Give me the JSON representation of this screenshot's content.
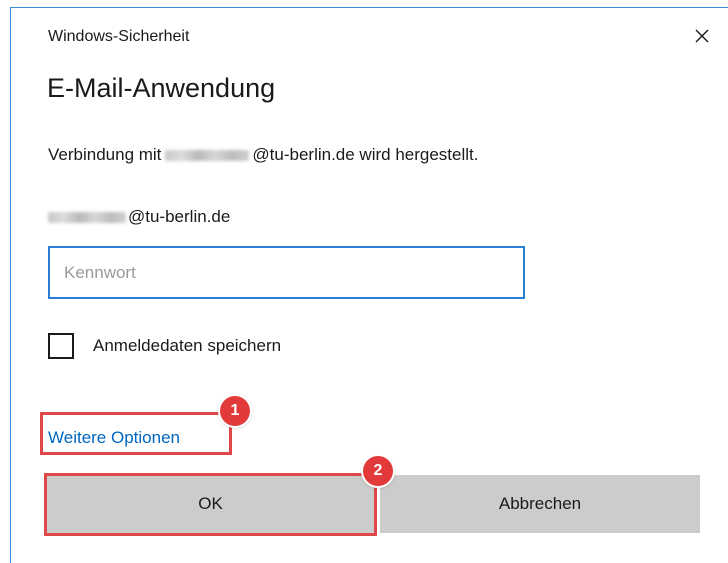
{
  "window": {
    "title": "Windows-Sicherheit",
    "close_icon": "close-icon"
  },
  "dialog": {
    "app_title": "E-Mail-Anwendung",
    "connect_prefix": "Verbindung mit",
    "connect_suffix": "@tu-berlin.de wird hergestellt.",
    "account_suffix": "@tu-berlin.de",
    "password_placeholder": "Kennwort",
    "password_value": "",
    "remember_label": "Anmeldedaten speichern",
    "remember_checked": false,
    "more_options_label": "Weitere Optionen",
    "ok_label": "OK",
    "cancel_label": "Abbrechen"
  },
  "annotations": {
    "step1": "1",
    "step2": "2",
    "highlight_color": "#e0464a"
  },
  "colors": {
    "accent": "#2a7fd4",
    "link": "#0067c0",
    "button_bg": "#cccccc"
  }
}
